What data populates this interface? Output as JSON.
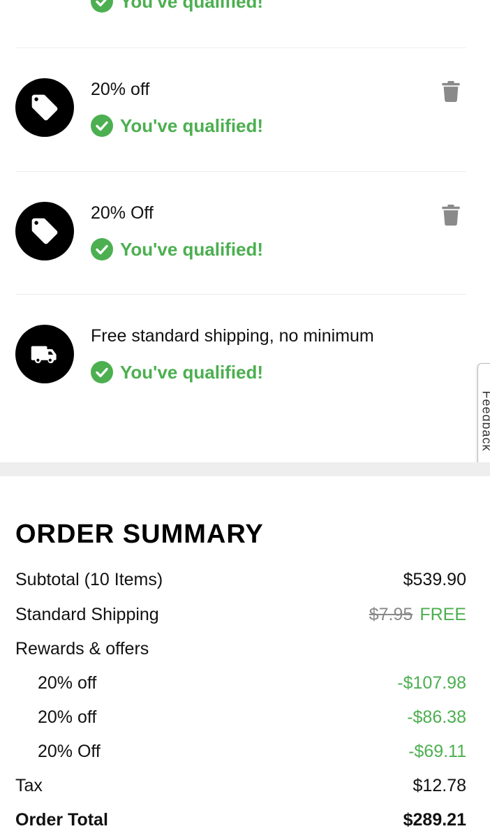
{
  "offers": [
    {
      "title": "",
      "icon": "tag-icon",
      "status": "You've qualified!",
      "removable": false
    },
    {
      "title": "20% off",
      "icon": "tag-icon",
      "status": "You've qualified!",
      "removable": true
    },
    {
      "title": "20% Off",
      "icon": "tag-icon",
      "status": "You've qualified!",
      "removable": true
    },
    {
      "title": "Free standard shipping, no minimum",
      "icon": "truck-icon",
      "status": "You've qualified!",
      "removable": false
    }
  ],
  "feedback_tab": {
    "label": "Feedback"
  },
  "summary": {
    "title": "ORDER SUMMARY",
    "subtotal_label": "Subtotal (10 Items)",
    "subtotal_value": "$539.90",
    "shipping_label": "Standard Shipping",
    "shipping_original": "$7.95",
    "shipping_value": "FREE",
    "rewards_label": "Rewards & offers",
    "discounts": [
      {
        "label": "20% off",
        "value": "-$107.98"
      },
      {
        "label": "20% off",
        "value": "-$86.38"
      },
      {
        "label": "20% Off",
        "value": "-$69.11"
      }
    ],
    "tax_label": "Tax",
    "tax_value": "$12.78",
    "total_label": "Order Total",
    "total_value": "$289.21"
  },
  "colors": {
    "accent_green": "#4caf50",
    "icon_black": "#000000",
    "trash_gray": "#8a8a8a",
    "band_gray": "#eeeeee"
  }
}
